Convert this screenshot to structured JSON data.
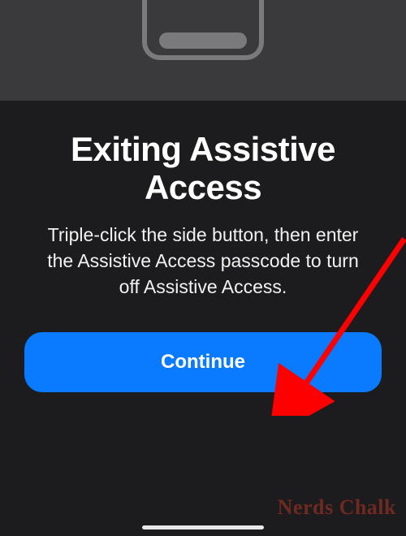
{
  "dialog": {
    "title": "Exiting Assistive Access",
    "subtitle": "Triple-click the side button, then enter the Assistive Access passcode to turn off Assistive Access.",
    "continue_label": "Continue"
  },
  "watermark": "Nerds Chalk"
}
